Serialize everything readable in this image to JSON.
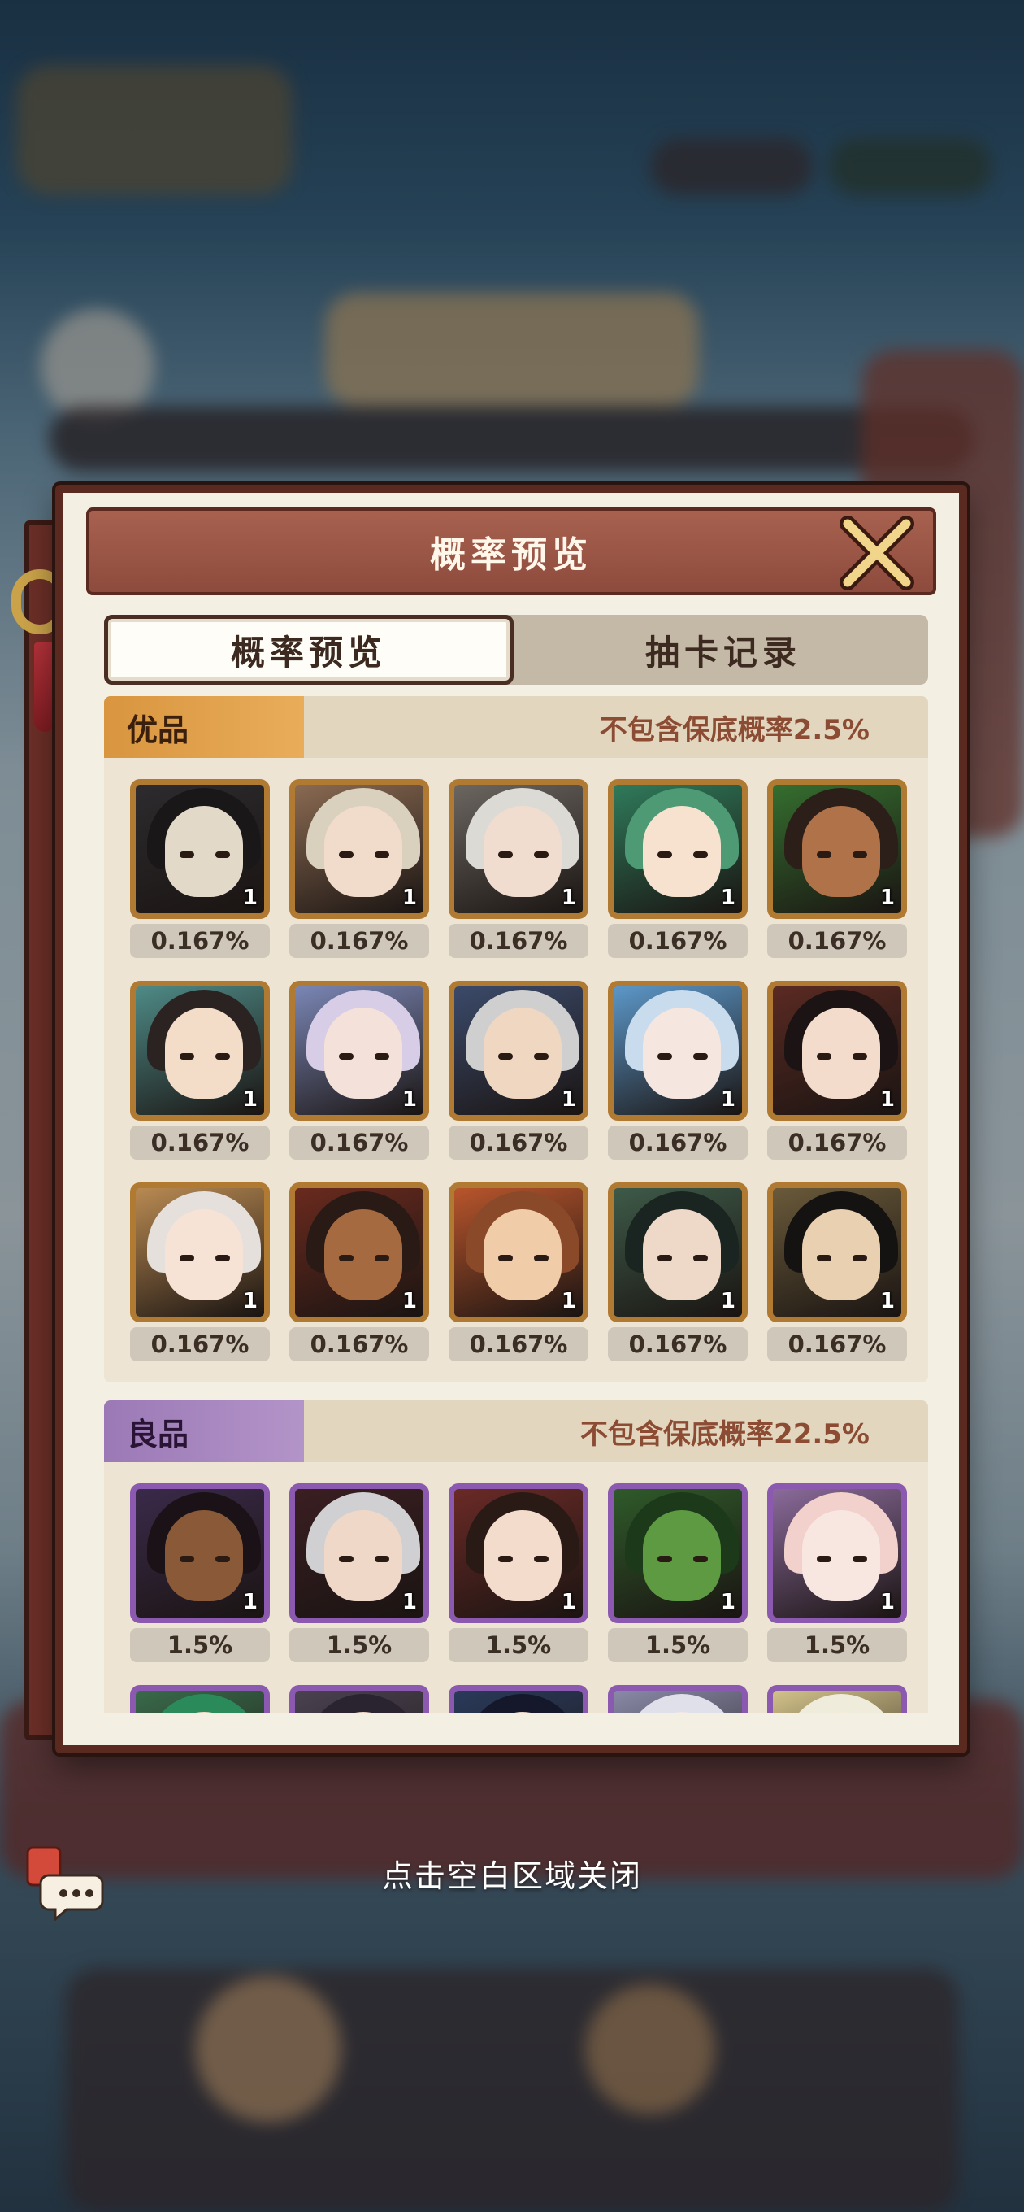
{
  "modal": {
    "title": "概率预览",
    "tabs": [
      {
        "label": "概率预览",
        "active": true
      },
      {
        "label": "抽卡记录",
        "active": false
      }
    ]
  },
  "sections": [
    {
      "tier": "优品",
      "color": "#d9953f",
      "note": "不包含保底概率2.5%",
      "cards": [
        {
          "count": "1",
          "rate": "0.167%",
          "palette": [
            "#2d2b2e",
            "#e2d9c9",
            "#1a1719"
          ]
        },
        {
          "count": "1",
          "rate": "0.167%",
          "palette": [
            "#8a6a52",
            "#f1dccb",
            "#d9d1bd"
          ]
        },
        {
          "count": "1",
          "rate": "0.167%",
          "palette": [
            "#6b6660",
            "#f0ddd0",
            "#dcdad4"
          ]
        },
        {
          "count": "1",
          "rate": "0.167%",
          "palette": [
            "#2f7a5a",
            "#f6e2cf",
            "#4d9a74"
          ]
        },
        {
          "count": "1",
          "rate": "0.167%",
          "palette": [
            "#356e2f",
            "#b07248",
            "#2c1e18"
          ]
        },
        {
          "count": "1",
          "rate": "0.167%",
          "palette": [
            "#4e8a86",
            "#f3ddc9",
            "#2b2322"
          ]
        },
        {
          "count": "1",
          "rate": "0.167%",
          "palette": [
            "#7a86b4",
            "#f4e2da",
            "#d7cde6"
          ]
        },
        {
          "count": "1",
          "rate": "0.167%",
          "palette": [
            "#3b4a6a",
            "#efd7c2",
            "#cfcfcf"
          ]
        },
        {
          "count": "1",
          "rate": "0.167%",
          "palette": [
            "#5c97c8",
            "#f6e6e0",
            "#c8dcee"
          ]
        },
        {
          "count": "1",
          "rate": "0.167%",
          "palette": [
            "#5a2a22",
            "#f3dccc",
            "#1c1414"
          ]
        },
        {
          "count": "1",
          "rate": "0.167%",
          "palette": [
            "#b98a52",
            "#f6e3d6",
            "#e6e0dc"
          ]
        },
        {
          "count": "1",
          "rate": "0.167%",
          "palette": [
            "#6a2a1e",
            "#a66a40",
            "#2a1a16"
          ]
        },
        {
          "count": "1",
          "rate": "0.167%",
          "palette": [
            "#b8552c",
            "#f0cda8",
            "#8a4a2a"
          ]
        },
        {
          "count": "1",
          "rate": "0.167%",
          "palette": [
            "#3e5a48",
            "#eed8c8",
            "#1a2420"
          ]
        },
        {
          "count": "1",
          "rate": "0.167%",
          "palette": [
            "#6a5a3a",
            "#e8d0b0",
            "#151212"
          ]
        }
      ]
    },
    {
      "tier": "良品",
      "color": "#9b79b6",
      "note": "不包含保底概率22.5%",
      "cards": [
        {
          "count": "1",
          "rate": "1.5%",
          "palette": [
            "#3a2a4a",
            "#8a5a38",
            "#1a1216"
          ]
        },
        {
          "count": "1",
          "rate": "1.5%",
          "palette": [
            "#3a1e22",
            "#f0d8c8",
            "#d0d0d2"
          ]
        },
        {
          "count": "1",
          "rate": "1.5%",
          "palette": [
            "#6a2a26",
            "#f3dccc",
            "#2a1a16"
          ]
        },
        {
          "count": "1",
          "rate": "1.5%",
          "palette": [
            "#2f5a2a",
            "#5e9a42",
            "#1c3a1a"
          ]
        },
        {
          "count": "1",
          "rate": "1.5%",
          "palette": [
            "#8a6a9a",
            "#f8e6e0",
            "#f2d0cc"
          ]
        },
        {
          "count": "",
          "rate": "",
          "palette": [
            "#3a6a4a",
            "#f2dccc",
            "#2a8a5a"
          ]
        },
        {
          "count": "",
          "rate": "",
          "palette": [
            "#4a4250",
            "#efd8c8",
            "#2a2430"
          ]
        },
        {
          "count": "",
          "rate": "",
          "palette": [
            "#2a3a5a",
            "#efd8c8",
            "#14182a"
          ]
        },
        {
          "count": "",
          "rate": "",
          "palette": [
            "#8a8aa8",
            "#f2e6e6",
            "#e0e0ea"
          ]
        },
        {
          "count": "",
          "rate": "",
          "palette": [
            "#d2c28a",
            "#f6ead8",
            "#f0ecdc"
          ]
        }
      ]
    }
  ],
  "footer": {
    "hint": "点击空白区域关闭"
  },
  "icons": {
    "close": "close-x-icon",
    "chat": "chat-bubble-icon"
  },
  "colors": {
    "frame": "#5a2a20",
    "title_bar": "#a8614f",
    "panel": "#f4efe3",
    "gold_border": "#b07a32",
    "purple_border": "#8b5ab0",
    "note_text": "#8c4b33"
  }
}
